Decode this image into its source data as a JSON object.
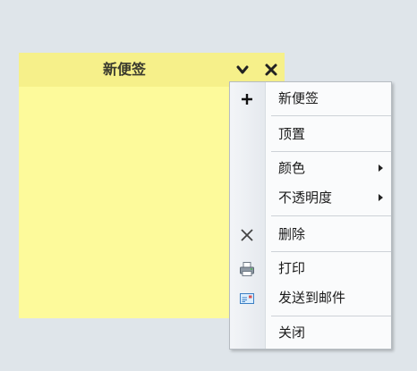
{
  "note": {
    "title": "新便签",
    "background": "#fdfa9b",
    "header_background": "#f6f08a",
    "buttons": [
      {
        "name": "collapse",
        "icon": "chevron-down-icon"
      },
      {
        "name": "close",
        "icon": "close-icon"
      }
    ]
  },
  "menu": {
    "items": [
      {
        "label": "新便签",
        "icon": "plus-icon",
        "submenu": false
      },
      {
        "label": "顶置",
        "icon": null,
        "submenu": false
      },
      {
        "label": "颜色",
        "icon": null,
        "submenu": true
      },
      {
        "label": "不透明度",
        "icon": null,
        "submenu": true
      },
      {
        "label": "删除",
        "icon": "delete-x-icon",
        "submenu": false
      },
      {
        "label": "打印",
        "icon": "printer-icon",
        "submenu": false
      },
      {
        "label": "发送到邮件",
        "icon": "email-icon",
        "submenu": false
      },
      {
        "label": "关闭",
        "icon": null,
        "submenu": false
      }
    ]
  }
}
